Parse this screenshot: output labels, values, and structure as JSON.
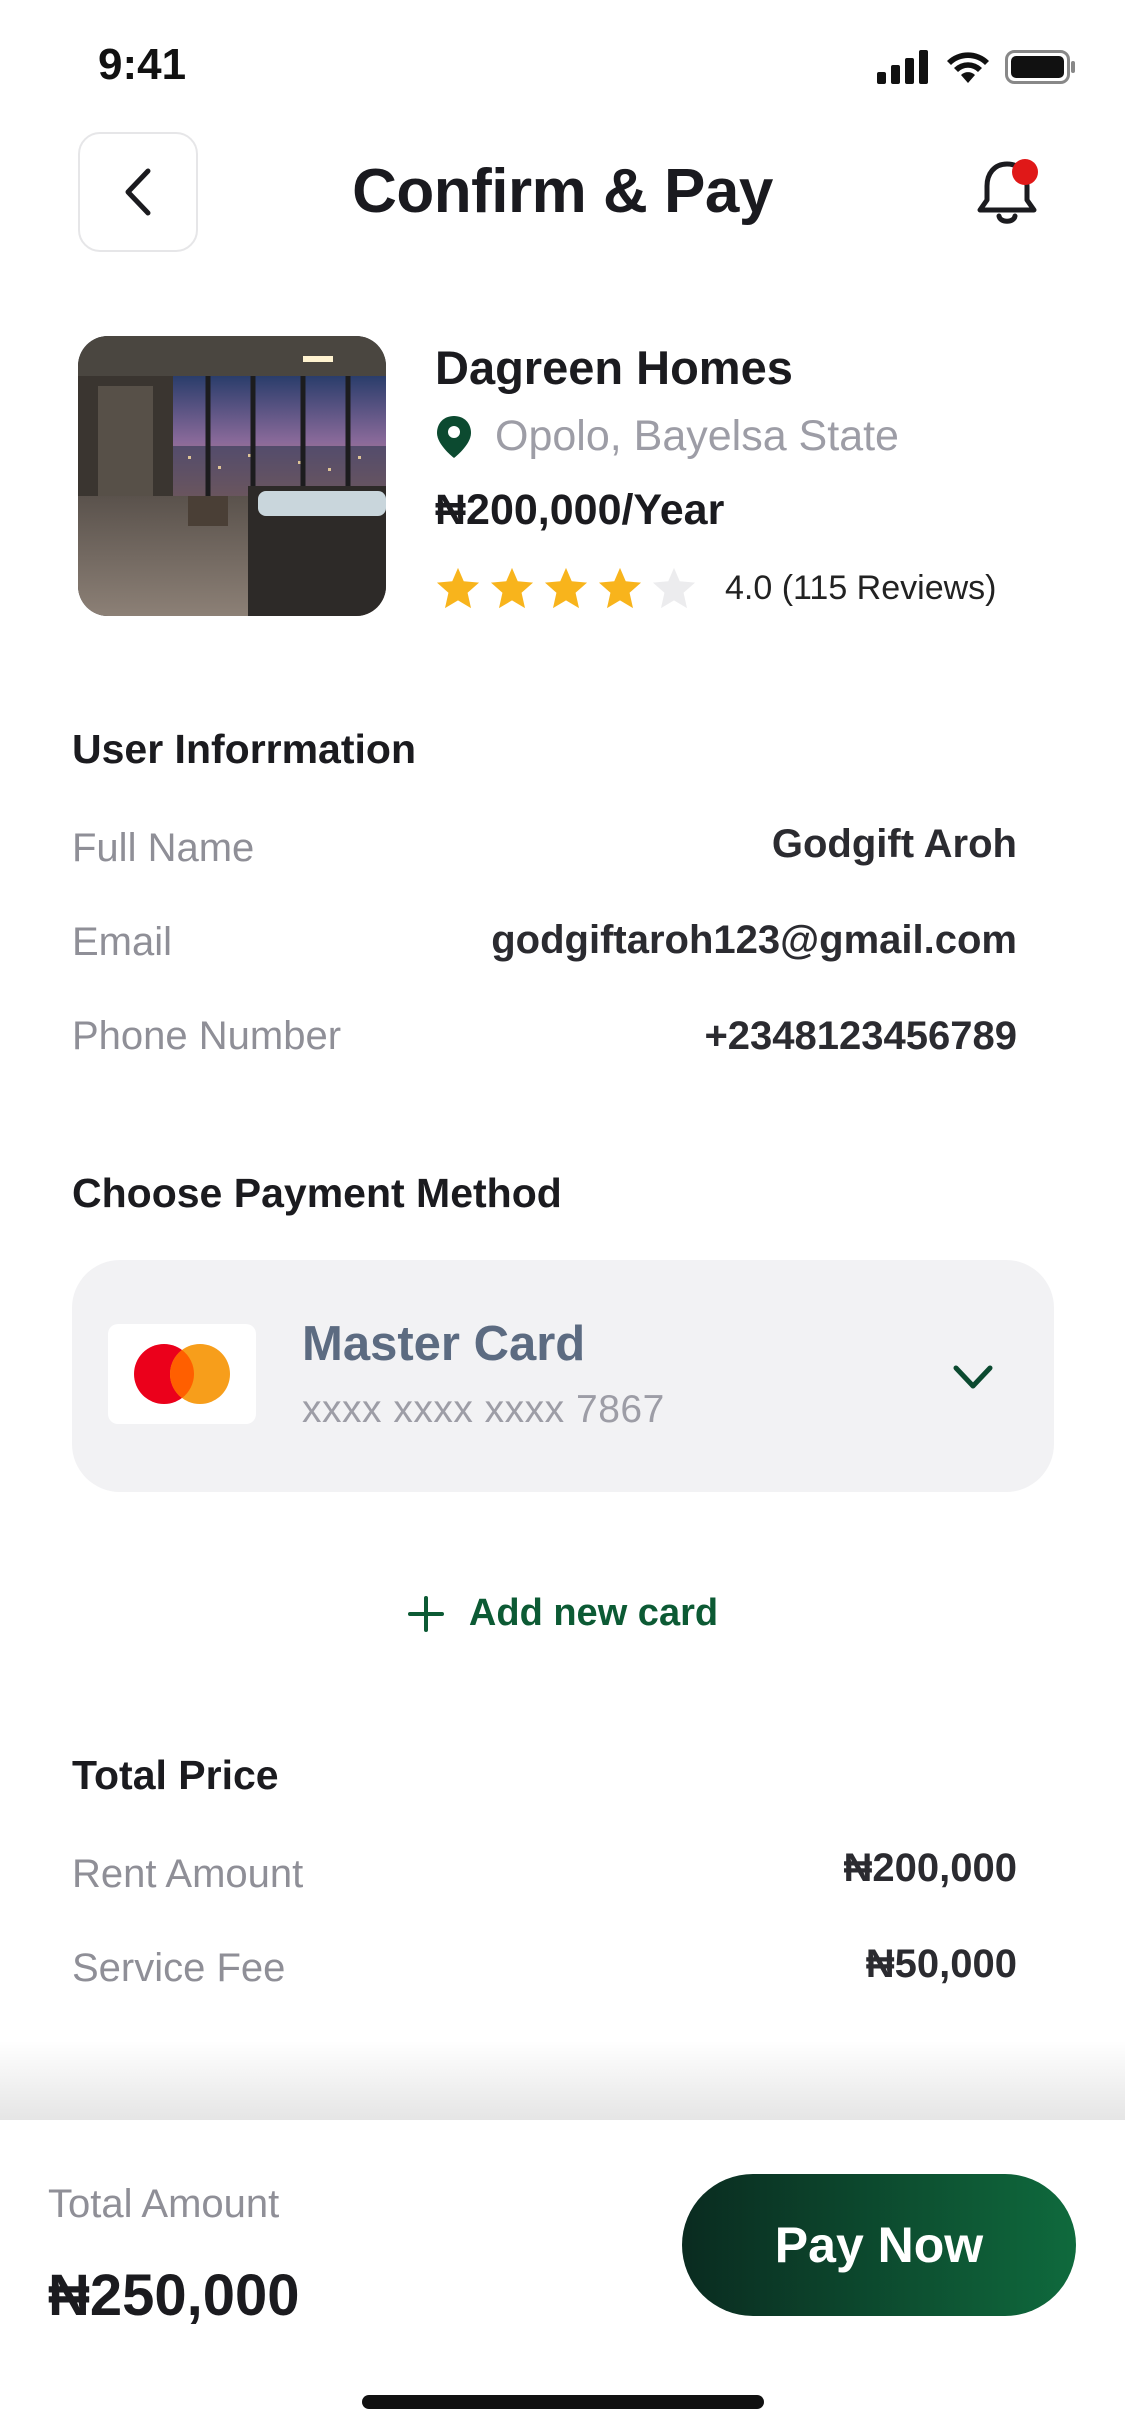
{
  "status_bar": {
    "time": "9:41"
  },
  "header": {
    "title": "Confirm & Pay"
  },
  "property": {
    "name": "Dagreen Homes",
    "location": "Opolo, Bayelsa State",
    "price": "₦200,000/Year",
    "rating": 4.0,
    "rating_text": "4.0 (115 Reviews)"
  },
  "user_info": {
    "title": "User Inforrmation",
    "rows": [
      {
        "label": "Full Name",
        "value": "Godgift Aroh"
      },
      {
        "label": "Email",
        "value": "godgiftaroh123@gmail.com"
      },
      {
        "label": "Phone Number",
        "value": "+2348123456789"
      }
    ]
  },
  "payment": {
    "title": "Choose Payment Method",
    "card_name": "Master Card",
    "card_number": "xxxx xxxx xxxx 7867",
    "add_card_label": "Add new card"
  },
  "total_price": {
    "title": "Total Price",
    "rows": [
      {
        "label": "Rent Amount",
        "value": "₦200,000"
      },
      {
        "label": "Service Fee",
        "value": "₦50,000"
      }
    ]
  },
  "footer": {
    "total_label": "Total Amount",
    "total_value": "₦250,000",
    "pay_button": "Pay Now"
  },
  "colors": {
    "brand_green": "#0f6a3d",
    "dark_green": "#0a2b20",
    "notification_dot": "#e01818",
    "star": "#f8b41c",
    "card_title": "#5c6b81"
  }
}
